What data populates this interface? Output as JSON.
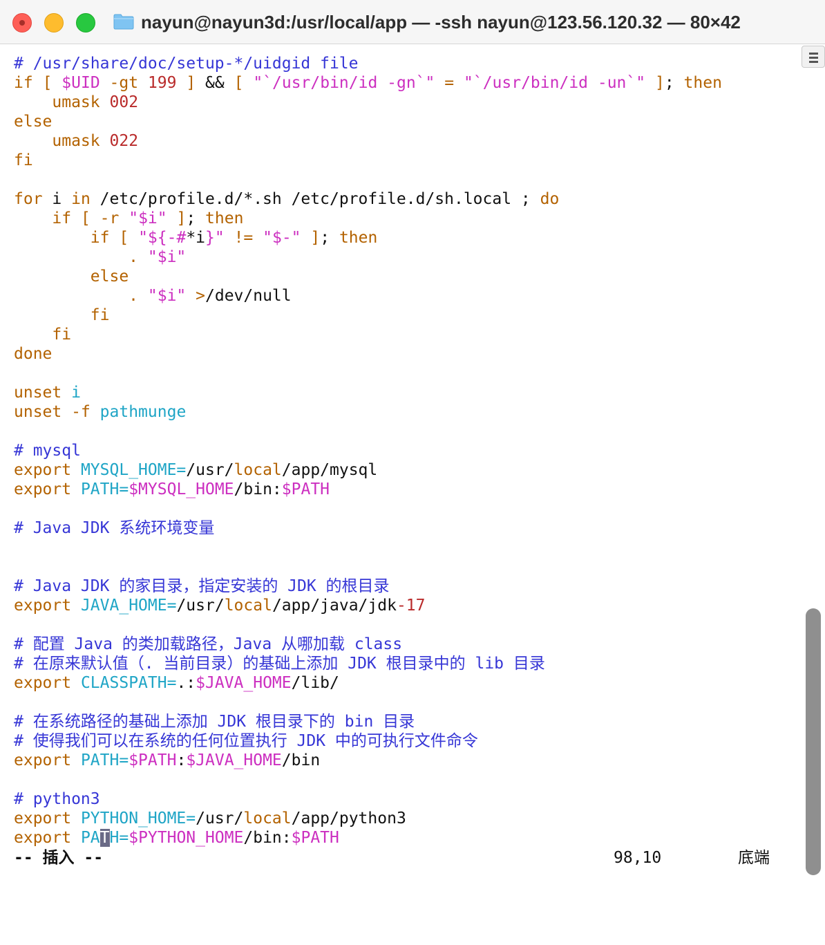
{
  "window": {
    "title": "nayun@nayun3d:/usr/local/app — -ssh nayun@123.56.120.32 — 80×42"
  },
  "editor": {
    "lines": [
      [
        {
          "t": "# /usr/share/doc/setup-*/uidgid file",
          "c": "cm"
        }
      ],
      [
        {
          "t": "if",
          "c": "kw"
        },
        {
          "t": " "
        },
        {
          "t": "[",
          "c": "kw"
        },
        {
          "t": " "
        },
        {
          "t": "$UID",
          "c": "st"
        },
        {
          "t": " "
        },
        {
          "t": "-gt",
          "c": "kw"
        },
        {
          "t": " "
        },
        {
          "t": "199",
          "c": "nm"
        },
        {
          "t": " "
        },
        {
          "t": "]",
          "c": "kw"
        },
        {
          "t": " && "
        },
        {
          "t": "[",
          "c": "kw"
        },
        {
          "t": " "
        },
        {
          "t": "\"`/usr/bin/id -gn`\"",
          "c": "st"
        },
        {
          "t": " "
        },
        {
          "t": "=",
          "c": "kw"
        },
        {
          "t": " "
        },
        {
          "t": "\"`/usr/bin/id -un`\"",
          "c": "st"
        },
        {
          "t": " "
        },
        {
          "t": "]",
          "c": "kw"
        },
        {
          "t": "; "
        },
        {
          "t": "then",
          "c": "kw"
        }
      ],
      [
        {
          "t": "    "
        },
        {
          "t": "umask",
          "c": "kw"
        },
        {
          "t": " "
        },
        {
          "t": "002",
          "c": "nm"
        }
      ],
      [
        {
          "t": "else",
          "c": "kw"
        }
      ],
      [
        {
          "t": "    "
        },
        {
          "t": "umask",
          "c": "kw"
        },
        {
          "t": " "
        },
        {
          "t": "022",
          "c": "nm"
        }
      ],
      [
        {
          "t": "fi",
          "c": "kw"
        }
      ],
      [],
      [
        {
          "t": "for",
          "c": "kw"
        },
        {
          "t": " i "
        },
        {
          "t": "in",
          "c": "kw"
        },
        {
          "t": " /etc/profile.d/*.sh /etc/profile.d/sh.local ; "
        },
        {
          "t": "do",
          "c": "kw"
        }
      ],
      [
        {
          "t": "    "
        },
        {
          "t": "if",
          "c": "kw"
        },
        {
          "t": " "
        },
        {
          "t": "[",
          "c": "kw"
        },
        {
          "t": " "
        },
        {
          "t": "-r",
          "c": "kw"
        },
        {
          "t": " "
        },
        {
          "t": "\"$i\"",
          "c": "st"
        },
        {
          "t": " "
        },
        {
          "t": "]",
          "c": "kw"
        },
        {
          "t": "; "
        },
        {
          "t": "then",
          "c": "kw"
        }
      ],
      [
        {
          "t": "        "
        },
        {
          "t": "if",
          "c": "kw"
        },
        {
          "t": " "
        },
        {
          "t": "[",
          "c": "kw"
        },
        {
          "t": " "
        },
        {
          "t": "\"${-#",
          "c": "st"
        },
        {
          "t": "*i"
        },
        {
          "t": "}\"",
          "c": "st"
        },
        {
          "t": " "
        },
        {
          "t": "!=",
          "c": "kw"
        },
        {
          "t": " "
        },
        {
          "t": "\"$-\"",
          "c": "st"
        },
        {
          "t": " "
        },
        {
          "t": "]",
          "c": "kw"
        },
        {
          "t": "; "
        },
        {
          "t": "then",
          "c": "kw"
        }
      ],
      [
        {
          "t": "            "
        },
        {
          "t": ".",
          "c": "kw"
        },
        {
          "t": " "
        },
        {
          "t": "\"$i\"",
          "c": "st"
        }
      ],
      [
        {
          "t": "        "
        },
        {
          "t": "else",
          "c": "kw"
        }
      ],
      [
        {
          "t": "            "
        },
        {
          "t": ".",
          "c": "kw"
        },
        {
          "t": " "
        },
        {
          "t": "\"$i\"",
          "c": "st"
        },
        {
          "t": " "
        },
        {
          "t": ">",
          "c": "kw"
        },
        {
          "t": "/dev/null"
        }
      ],
      [
        {
          "t": "        "
        },
        {
          "t": "fi",
          "c": "kw"
        }
      ],
      [
        {
          "t": "    "
        },
        {
          "t": "fi",
          "c": "kw"
        }
      ],
      [
        {
          "t": "done",
          "c": "kw"
        }
      ],
      [],
      [
        {
          "t": "unset",
          "c": "kw"
        },
        {
          "t": " "
        },
        {
          "t": "i",
          "c": "vr"
        }
      ],
      [
        {
          "t": "unset",
          "c": "kw"
        },
        {
          "t": " "
        },
        {
          "t": "-f",
          "c": "kw"
        },
        {
          "t": " "
        },
        {
          "t": "pathmunge",
          "c": "vr"
        }
      ],
      [],
      [
        {
          "t": "# mysql",
          "c": "cm"
        }
      ],
      [
        {
          "t": "export",
          "c": "kw"
        },
        {
          "t": " "
        },
        {
          "t": "MYSQL_HOME=",
          "c": "vr"
        },
        {
          "t": "/usr/"
        },
        {
          "t": "local",
          "c": "kw"
        },
        {
          "t": "/app/mysql"
        }
      ],
      [
        {
          "t": "export",
          "c": "kw"
        },
        {
          "t": " "
        },
        {
          "t": "PATH=",
          "c": "vr"
        },
        {
          "t": "$MYSQL_HOME",
          "c": "st"
        },
        {
          "t": "/bin:"
        },
        {
          "t": "$PATH",
          "c": "st"
        }
      ],
      [],
      [
        {
          "t": "# Java JDK 系统环境变量",
          "c": "cm"
        }
      ],
      [],
      [],
      [
        {
          "t": "# Java JDK 的家目录，指定安装的 JDK 的根目录",
          "c": "cm"
        }
      ],
      [
        {
          "t": "export",
          "c": "kw"
        },
        {
          "t": " "
        },
        {
          "t": "JAVA_HOME=",
          "c": "vr"
        },
        {
          "t": "/usr/"
        },
        {
          "t": "local",
          "c": "kw"
        },
        {
          "t": "/app/java/jdk"
        },
        {
          "t": "-17",
          "c": "nm"
        }
      ],
      [],
      [
        {
          "t": "# 配置 Java 的类加载路径，Java 从哪加载 class",
          "c": "cm"
        }
      ],
      [
        {
          "t": "# 在原来默认值（. 当前目录）的基础上添加 JDK 根目录中的 lib 目录",
          "c": "cm"
        }
      ],
      [
        {
          "t": "export",
          "c": "kw"
        },
        {
          "t": " "
        },
        {
          "t": "CLASSPATH=",
          "c": "vr"
        },
        {
          "t": ".:"
        },
        {
          "t": "$JAVA_HOME",
          "c": "st"
        },
        {
          "t": "/lib/"
        }
      ],
      [],
      [
        {
          "t": "# 在系统路径的基础上添加 JDK 根目录下的 bin 目录",
          "c": "cm"
        }
      ],
      [
        {
          "t": "# 使得我们可以在系统的任何位置执行 JDK 中的可执行文件命令",
          "c": "cm"
        }
      ],
      [
        {
          "t": "export",
          "c": "kw"
        },
        {
          "t": " "
        },
        {
          "t": "PATH=",
          "c": "vr"
        },
        {
          "t": "$PATH",
          "c": "st"
        },
        {
          "t": ":"
        },
        {
          "t": "$JAVA_HOME",
          "c": "st"
        },
        {
          "t": "/bin"
        }
      ],
      [],
      [
        {
          "t": "# python3",
          "c": "cm"
        }
      ],
      [
        {
          "t": "export",
          "c": "kw"
        },
        {
          "t": " "
        },
        {
          "t": "PYTHON_HOME=",
          "c": "vr"
        },
        {
          "t": "/usr/"
        },
        {
          "t": "local",
          "c": "kw"
        },
        {
          "t": "/app/python3"
        }
      ],
      [
        {
          "t": "export",
          "c": "kw"
        },
        {
          "t": " "
        },
        {
          "t": "PA",
          "c": "vr"
        },
        {
          "t": "T",
          "c": "cursor"
        },
        {
          "t": "H=",
          "c": "vr"
        },
        {
          "t": "$PYTHON_HOME",
          "c": "st"
        },
        {
          "t": "/bin:"
        },
        {
          "t": "$PATH",
          "c": "st"
        }
      ]
    ]
  },
  "status": {
    "mode": "-- 插入 --",
    "position": "98,10",
    "location": "底端"
  },
  "colors": {
    "comment": "#3636d6",
    "keyword": "#b36200",
    "string": "#cc2fc0",
    "number": "#b92a2a",
    "variable": "#1fa5c6",
    "text": "#111111"
  }
}
